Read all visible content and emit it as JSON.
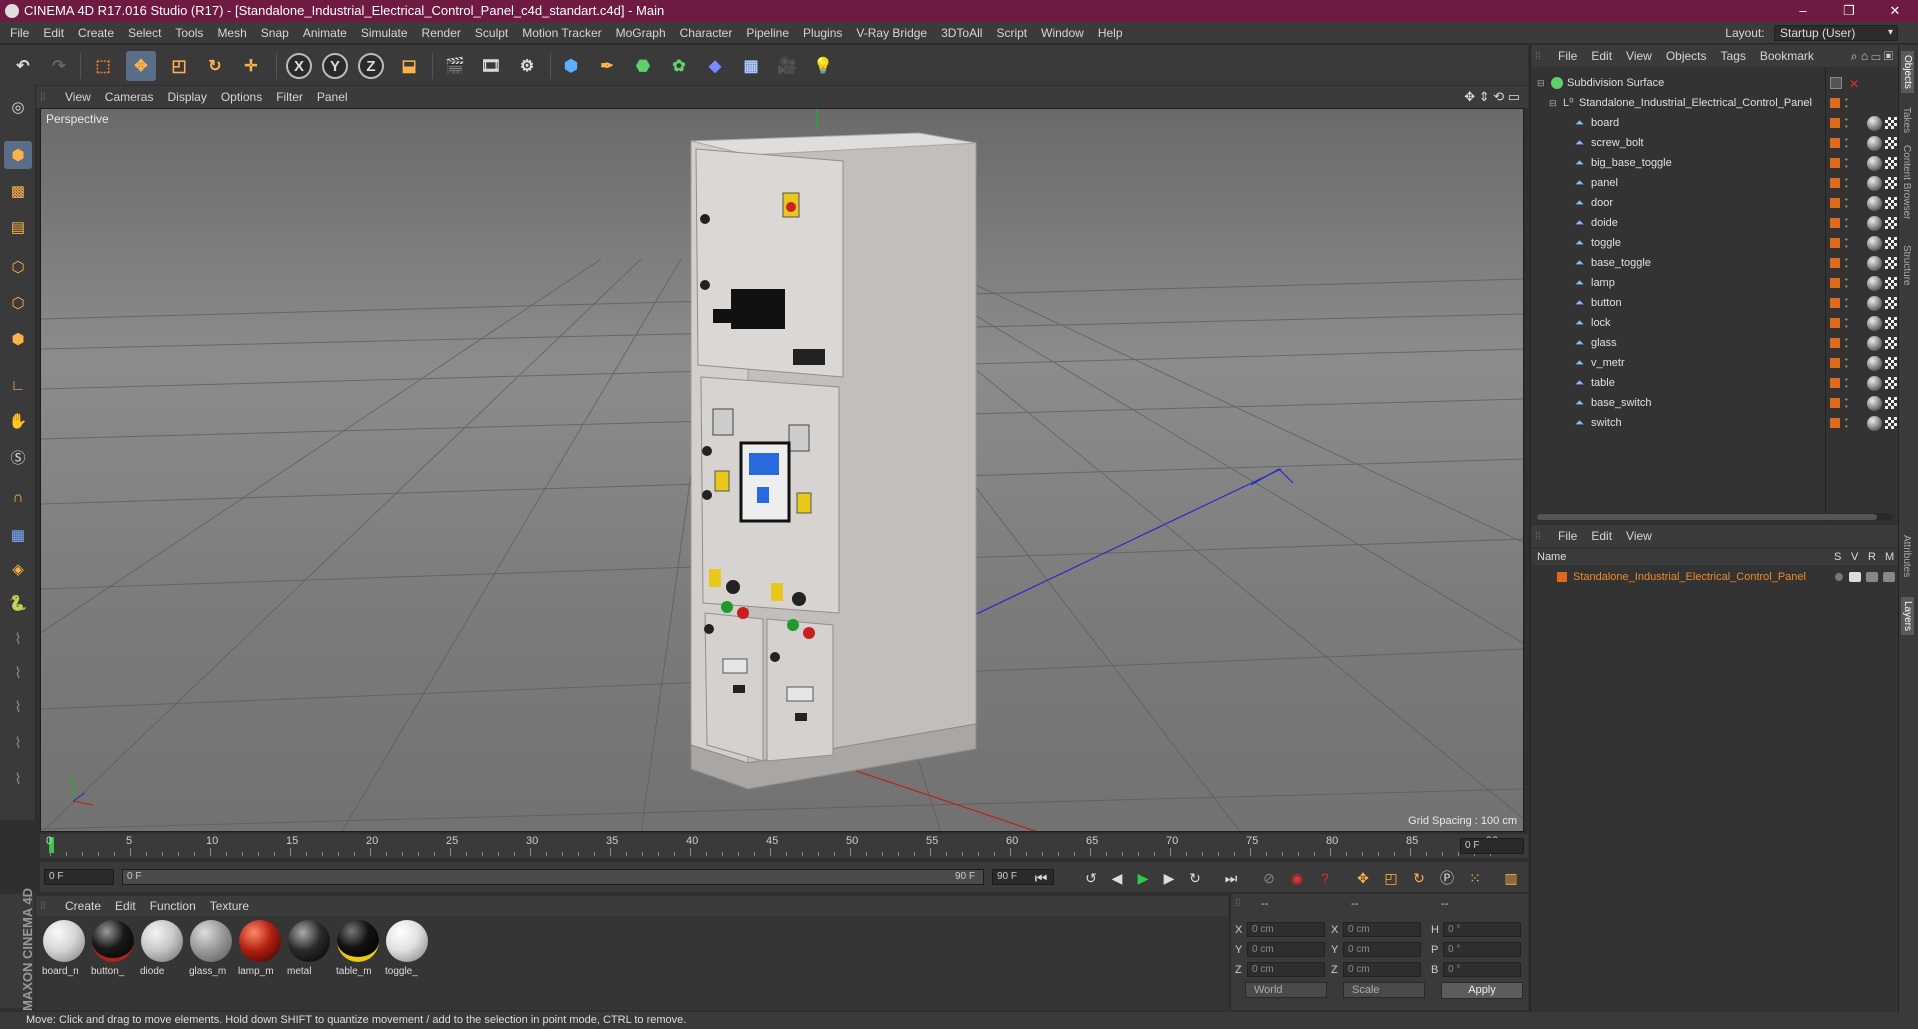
{
  "window": {
    "title": "CINEMA 4D R17.016 Studio (R17) - [Standalone_Industrial_Electrical_Control_Panel_c4d_standart.c4d] - Main",
    "controls": [
      "–",
      "❐",
      "✕"
    ]
  },
  "menubar": {
    "items": [
      "File",
      "Edit",
      "Create",
      "Select",
      "Tools",
      "Mesh",
      "Snap",
      "Animate",
      "Simulate",
      "Render",
      "Sculpt",
      "Motion Tracker",
      "MoGraph",
      "Character",
      "Pipeline",
      "Plugins",
      "V-Ray Bridge",
      "3DToAll",
      "Script",
      "Window",
      "Help"
    ],
    "layout_label": "Layout:",
    "layout_value": "Startup (User)"
  },
  "toolbar": {
    "axis_x": "X",
    "axis_y": "Y",
    "axis_z": "Z"
  },
  "viewport": {
    "menu": [
      "View",
      "Cameras",
      "Display",
      "Options",
      "Filter",
      "Panel"
    ],
    "camera_label": "Perspective",
    "grid_spacing": "Grid Spacing : 100 cm"
  },
  "timeline": {
    "ticks": [
      "0",
      "5",
      "10",
      "15",
      "20",
      "25",
      "30",
      "35",
      "40",
      "45",
      "50",
      "55",
      "60",
      "65",
      "70",
      "75",
      "80",
      "85",
      "90"
    ],
    "current_frame": "0 F"
  },
  "transport": {
    "start_field": "0 F",
    "range_start": "0 F",
    "range_end": "90 F",
    "end_field": "90 F"
  },
  "materials": {
    "menu": [
      "Create",
      "Edit",
      "Function",
      "Texture"
    ],
    "items": [
      {
        "label": "board_n",
        "color": "#d6d6d6"
      },
      {
        "label": "button_",
        "color": "#1a1a1a"
      },
      {
        "label": "diode",
        "color": "#c8c8c8"
      },
      {
        "label": "glass_m",
        "color": "#9a9a9a"
      },
      {
        "label": "lamp_m",
        "color": "#b02010"
      },
      {
        "label": "metal",
        "color": "#2a2a2a"
      },
      {
        "label": "table_m",
        "color": "#111111"
      },
      {
        "label": "toggle_",
        "color": "#e0e0e0"
      }
    ],
    "brand": "MAXON CINEMA 4D"
  },
  "coordinates": {
    "header": [
      "--",
      "--",
      "--"
    ],
    "rows": [
      {
        "a": "X",
        "av": "0 cm",
        "b": "X",
        "bv": "0 cm",
        "c": "H",
        "cv": "0 °"
      },
      {
        "a": "Y",
        "av": "0 cm",
        "b": "Y",
        "bv": "0 cm",
        "c": "P",
        "cv": "0 °"
      },
      {
        "a": "Z",
        "av": "0 cm",
        "b": "Z",
        "bv": "0 cm",
        "c": "B",
        "cv": "0 °"
      }
    ],
    "mode": "World",
    "scale": "Scale",
    "apply": "Apply"
  },
  "object_manager": {
    "menu": [
      "File",
      "Edit",
      "View",
      "Objects",
      "Tags",
      "Bookmark"
    ],
    "root": "Subdivision Surface",
    "group": "Standalone_Industrial_Electrical_Control_Panel",
    "children": [
      "board",
      "screw_bolt",
      "big_base_toggle",
      "panel",
      "door",
      "doide",
      "toggle",
      "base_toggle",
      "lamp",
      "button",
      "lock",
      "glass",
      "v_metr",
      "table",
      "base_switch",
      "switch"
    ]
  },
  "layer_manager": {
    "menu": [
      "File",
      "Edit",
      "View"
    ],
    "columns": [
      "Name",
      "S",
      "V",
      "R",
      "M"
    ],
    "layer": "Standalone_Industrial_Electrical_Control_Panel"
  },
  "right_tabs": [
    "Objects",
    "Takes",
    "Content Browser",
    "Structure",
    "Attributes",
    "Layers"
  ],
  "status": "Move: Click and drag to move elements. Hold down SHIFT to quantize movement / add to the selection in point mode, CTRL to remove.",
  "colors": {
    "title_bar": "#6e1a42",
    "accent_orange": "#e06a1b",
    "layer_text": "#f08a28"
  }
}
